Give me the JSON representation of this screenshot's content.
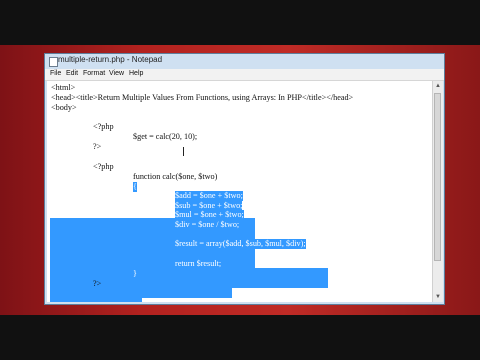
{
  "window": {
    "title": "multiple-return.php - Notepad"
  },
  "menu": {
    "file": "File",
    "edit": "Edit",
    "format": "Format",
    "view": "View",
    "help": "Help"
  },
  "code": {
    "l1": "<html>",
    "l2": "<head><title>Return Multiple Values From Functions, using Arrays: In PHP</title></head>",
    "l3": "<body>",
    "l4": "<?php",
    "l5": "$get = calc(20, 10);",
    "l6": "?>",
    "l7": "<?php",
    "l8": "function calc($one, $two)",
    "l9": "{",
    "l10": "$add = $one + $two;",
    "l11": "$sub = $one + $two;",
    "l12": "$mul = $one + $two;",
    "l13": "$div = $one / $two;",
    "l14": "$result = array($add, $sub, $mul, $div);",
    "l15": "return $result;",
    "l16": "}",
    "l17": "?>"
  },
  "icons": {
    "app": "notepad-icon",
    "scroll_up": "scroll-up-arrow-icon",
    "scroll_down": "scroll-down-arrow-icon"
  },
  "colors": {
    "selection": "#3399ff",
    "desktop": "#b3221f"
  }
}
